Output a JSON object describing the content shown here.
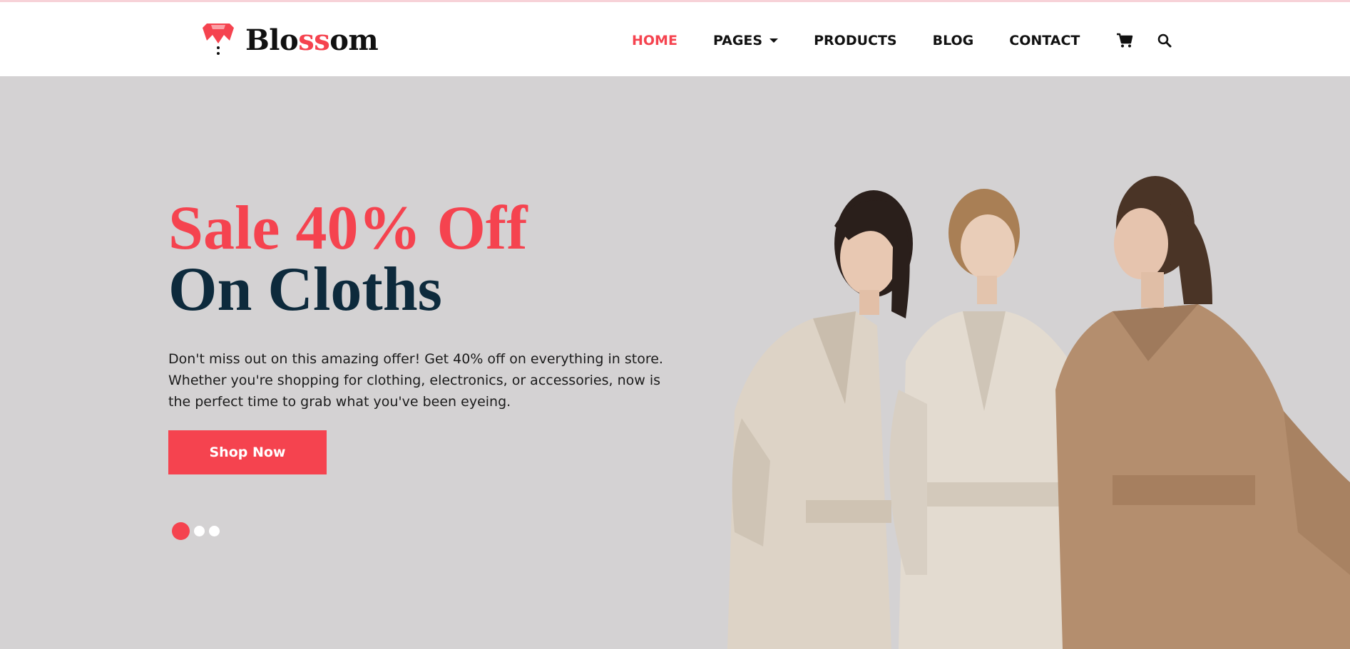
{
  "brand": {
    "name_prefix": "Blo",
    "name_accent": "ss",
    "name_suffix": "om",
    "accent_color": "#f5434f",
    "dark_color": "#0d2a3c"
  },
  "nav": {
    "items": [
      {
        "label": "HOME",
        "active": true
      },
      {
        "label": "PAGES",
        "has_dropdown": true
      },
      {
        "label": "PRODUCTS"
      },
      {
        "label": "BLOG"
      },
      {
        "label": "CONTACT"
      }
    ],
    "icons": [
      "cart-icon",
      "search-icon"
    ]
  },
  "hero": {
    "headline_line1": "Sale 40% Off",
    "headline_line2": "On Cloths",
    "description": "Don't miss out on this amazing offer! Get 40% off on everything in store. Whether you're shopping for clothing, electronics, or accessories, now is the perfect time to grab what you've been eyeing.",
    "cta_label": "Shop Now",
    "slider": {
      "total": 3,
      "active": 1
    },
    "background_color": "#d4d2d3"
  }
}
